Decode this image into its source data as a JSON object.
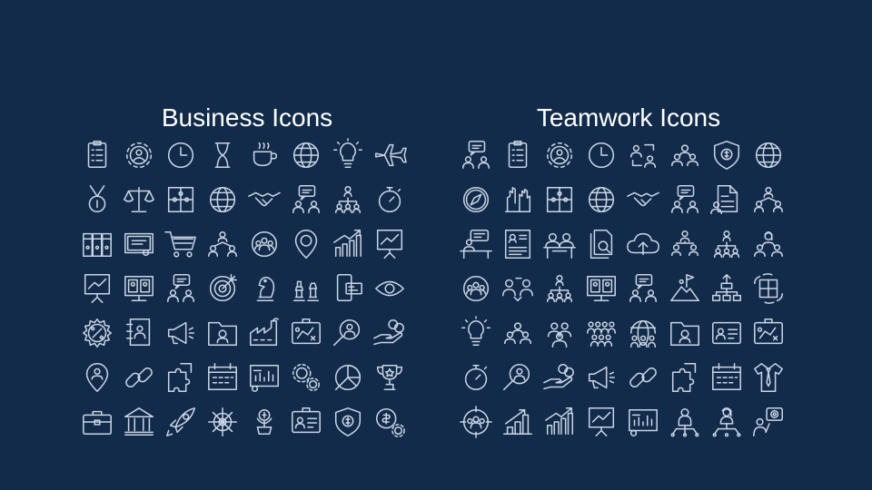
{
  "slide": {
    "background": "#122b4a",
    "icon_color": "#c9d4e4"
  },
  "business": {
    "title": "Business Icons",
    "icons": [
      "clipboard-checklist-icon",
      "gear-person-icon",
      "clock-icon",
      "hourglass-icon",
      "coffee-cup-icon",
      "globe-person-icon",
      "lightbulb-idea-icon",
      "airplane-icon",
      "medal-icon",
      "scales-icon",
      "puzzle-icon",
      "globe-arrows-icon",
      "handshake-icon",
      "chat-people-icon",
      "org-chart-people-icon",
      "stopwatch-icon",
      "binders-icon",
      "certificate-icon",
      "shopping-cart-icon",
      "network-people-icon",
      "team-circle-icon",
      "location-dollar-icon",
      "growth-chart-icon",
      "presentation-easel-icon",
      "presenter-chart-icon",
      "video-conference-icon",
      "person-idea-icon",
      "target-icon",
      "chess-knight-icon",
      "chess-pieces-icon",
      "mobile-card-icon",
      "eye-icon",
      "percent-badge-icon",
      "address-book-icon",
      "megaphone-icon",
      "folder-person-icon",
      "factory-icon",
      "strategy-board-icon",
      "magnifier-person-icon",
      "hand-coins-icon",
      "location-person-icon",
      "chain-link-icon",
      "puzzle-pieces-icon",
      "calendar-gear-icon",
      "dashboard-chart-icon",
      "gears-icon",
      "radar-pie-icon",
      "trophy-icon",
      "briefcase-icon",
      "bank-icon",
      "rocket-icon",
      "ship-wheel-icon",
      "plant-dollar-icon",
      "id-card-icon",
      "shield-dollar-icon",
      "dollar-gears-icon"
    ]
  },
  "teamwork": {
    "title": "Teamwork Icons",
    "icons": [
      "person-idea-icon",
      "clipboard-checklist-icon",
      "gear-person-icon",
      "clock-icon",
      "people-exchange-icon",
      "team-people-icon",
      "shield-person-icon",
      "globe-person-icon",
      "compass-icon",
      "hands-raised-icon",
      "puzzle-icon",
      "globe-arrows-icon",
      "handshake-icon",
      "chat-people-icon",
      "document-person-icon",
      "network-people-icon",
      "desk-chat-icon",
      "resume-icon",
      "meeting-people-icon",
      "documents-search-icon",
      "cloud-upload-icon",
      "team-structure-icon",
      "org-chart-people-icon",
      "team-women-icon",
      "team-circle-icon",
      "people-transfer-icon",
      "org-chart-people-icon",
      "video-conference-icon",
      "person-idea-icon",
      "summit-flag-icon",
      "hierarchy-arrows-icon",
      "puzzle-hands-icon",
      "lightbulb-idea-icon",
      "team-people-icon",
      "group-people-icon",
      "crowd-icon",
      "globe-people-icon",
      "folder-person-icon",
      "id-badge-icon",
      "strategy-board-icon",
      "stopwatch-icon",
      "magnifier-person-icon",
      "hand-coins-icon",
      "megaphone-icon",
      "chain-link-icon",
      "puzzle-pieces-icon",
      "calendar-icon",
      "shirt-tie-icon",
      "target-team-icon",
      "growth-bars-icon",
      "growth-chart-icon",
      "presentation-easel-icon",
      "dashboard-chart-icon",
      "manager-network-icon",
      "woman-network-icon",
      "presenter-target-icon"
    ]
  }
}
